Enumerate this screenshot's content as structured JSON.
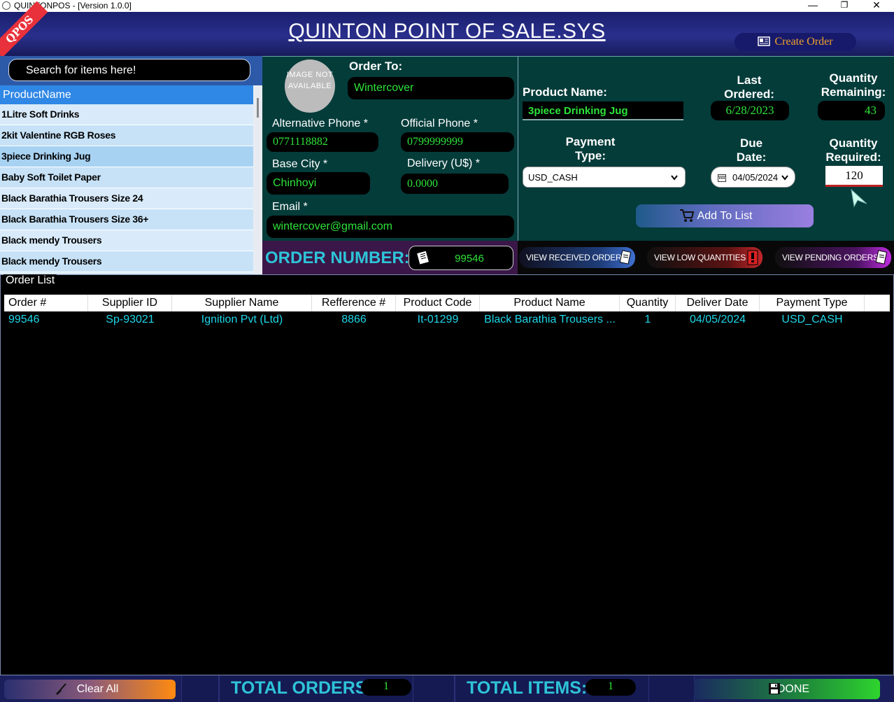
{
  "window": {
    "title": "QUINTONPOS - [Version 1.0.0]",
    "minimize": "—",
    "maximize": "❐",
    "close": "✕"
  },
  "header": {
    "ribbon": "QPOS",
    "title": "QUINTON POINT OF SALE.SYS",
    "create_order_label": "Create Order"
  },
  "search": {
    "placeholder": "Search for items here!"
  },
  "product_list": {
    "header": "ProductName",
    "items": [
      "1Litre Soft Drinks",
      "2kit Valentine RGB Roses",
      "3piece Drinking Jug",
      "Baby Soft Toilet Paper",
      "Black Barathia Trousers Size 24",
      "Black Barathia Trousers Size 36+",
      "Black mendy Trousers",
      "Black mendy Trousers"
    ]
  },
  "supplier": {
    "image_placeholder": "IMAGE NOT AVAILABLE",
    "order_to_label": "Order To:",
    "order_to_value": "Wintercover",
    "alt_phone_label": "Alternative Phone *",
    "alt_phone_value": "0771118882",
    "official_phone_label": "Official Phone *",
    "official_phone_value": "0799999999",
    "base_city_label": "Base City *",
    "base_city_value": "Chinhoyi",
    "delivery_label": "Delivery (U$) *",
    "delivery_value": "0.0000",
    "email_label": "Email *",
    "email_value": "wintercover@gmail.com"
  },
  "product": {
    "name_label": "Product Name:",
    "name_value": "3piece Drinking Jug",
    "last_ordered_label": "Last Ordered:",
    "last_ordered_value": "6/28/2023",
    "qty_remaining_label": "Quantity Remaining:",
    "qty_remaining_value": "43",
    "payment_type_label": "Payment Type:",
    "payment_type_value": "USD_CASH",
    "due_date_label": "Due Date:",
    "due_date_value": "04/05/2024",
    "qty_required_label": "Quantity Required:",
    "qty_required_value": "120",
    "add_to_list_label": "Add To List"
  },
  "order_number": {
    "label": "ORDER NUMBER:",
    "value": "99546"
  },
  "view_buttons": {
    "received": "VIEW RECEIVED ORDERS",
    "low": "VIEW LOW QUANTITIES",
    "pending": "VIEW PENDING ORDERS"
  },
  "order_list": {
    "legend": "Order List",
    "columns": [
      "Order #",
      "Supplier ID",
      "Supplier Name",
      "Refference #",
      "Product Code",
      "Product Name",
      "Quantity",
      "Deliver Date",
      "Payment Type"
    ],
    "rows": [
      [
        "99546",
        "Sp-93021",
        "Ignition Pvt (Ltd)",
        "8866",
        "It-01299",
        "Black Barathia Trousers ...",
        "1",
        "04/05/2024",
        "USD_CASH"
      ]
    ]
  },
  "footer": {
    "clear_all_label": "Clear All",
    "total_orders_label": "TOTAL ORDERS:",
    "total_orders_value": "1",
    "total_items_label": "TOTAL ITEMS:",
    "total_items_value": "1",
    "done_label": "DONE"
  },
  "colors": {
    "panel_teal": "#043c3a",
    "value_green": "#2ee33a",
    "grid_cyan": "#1ed6e8",
    "header_blue": "#1a1f6e"
  }
}
